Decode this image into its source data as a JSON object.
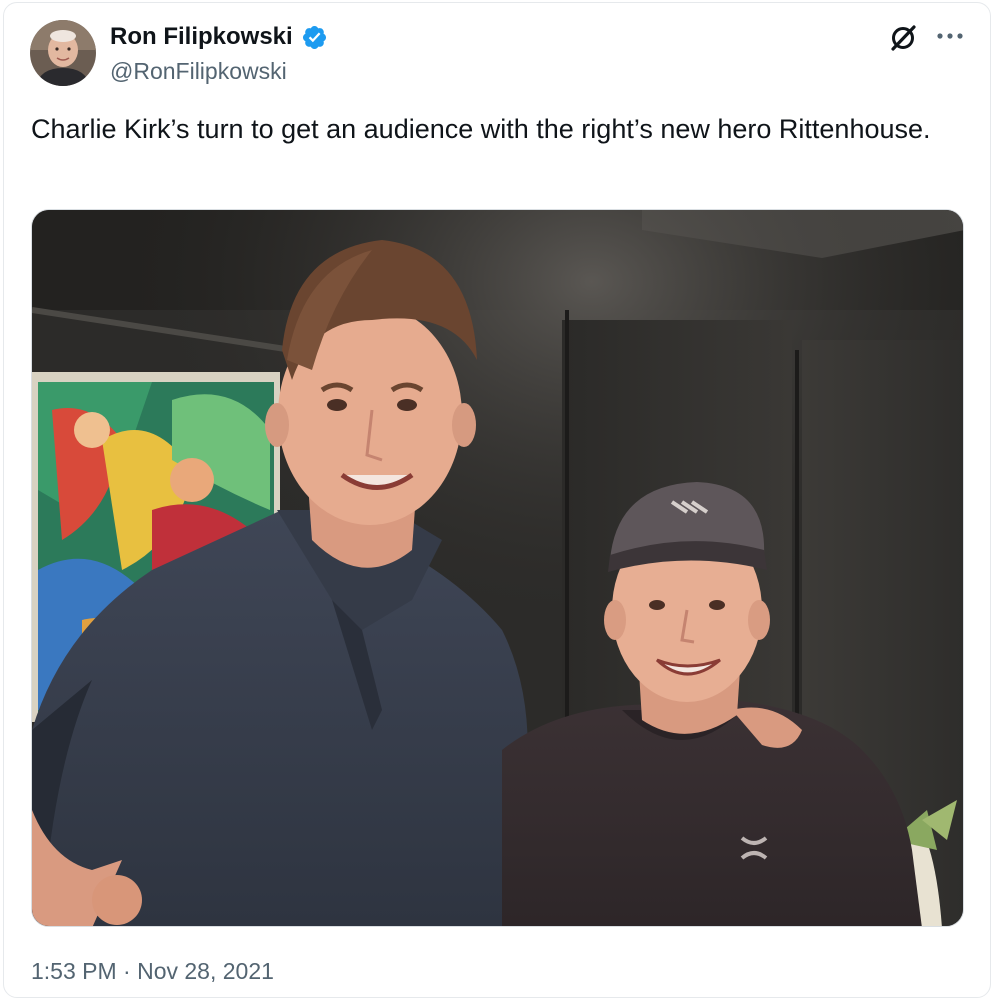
{
  "author": {
    "display_name": "Ron Filipkowski",
    "handle": "@RonFilipkowski",
    "verified": true
  },
  "tweet": {
    "text": "Charlie Kirk’s turn to get an audience with the right’s new hero Rittenhouse.",
    "media_alt": "Photo of two young men posing in a dark-walled room next to a colorful painting",
    "timestamp": "1:53 PM · Nov 28, 2021"
  },
  "icons": {
    "header_logo": "x-logo-icon",
    "more": "more-options-icon",
    "verified": "verified-badge-icon"
  },
  "colors": {
    "text_primary": "#0f1419",
    "text_secondary": "#536471",
    "verified_blue": "#1d9bf0",
    "border": "#e6e9ec"
  }
}
